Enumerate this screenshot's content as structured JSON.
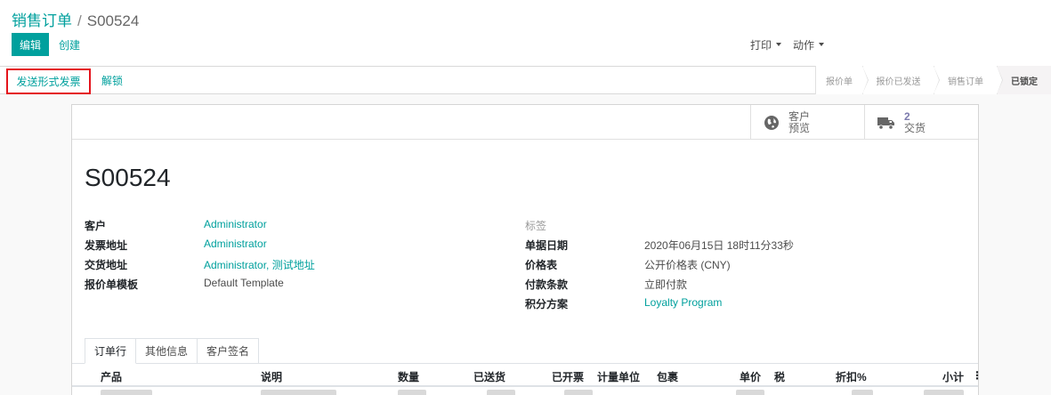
{
  "breadcrumb": {
    "parent": "销售订单",
    "current": "S00524"
  },
  "toolbar": {
    "edit": "编辑",
    "create": "创建",
    "print": "打印",
    "action": "动作"
  },
  "statusbar": {
    "send_proforma": "发送形式发票",
    "unlock": "解锁",
    "stages": [
      {
        "label": "报价单",
        "active": false
      },
      {
        "label": "报价已发送",
        "active": false
      },
      {
        "label": "销售订单",
        "active": false
      },
      {
        "label": "已锁定",
        "active": true
      }
    ]
  },
  "smart_buttons": {
    "preview_line1": "客户",
    "preview_line2": "预览",
    "delivery_count": "2",
    "delivery_label": "交货"
  },
  "record": {
    "name": "S00524",
    "left_fields": [
      {
        "label": "客户",
        "value": "Administrator"
      },
      {
        "label": "发票地址",
        "value": "Administrator"
      },
      {
        "label": "交货地址",
        "value": "Administrator, 测试地址"
      },
      {
        "label": "报价单模板",
        "value": "Default Template"
      }
    ],
    "tags_label": "标签",
    "right_fields": [
      {
        "label": "单据日期",
        "value": "2020年06月15日 18时11分33秒"
      },
      {
        "label": "价格表",
        "value": "公开价格表 (CNY)"
      },
      {
        "label": "付款条款",
        "value": "立即付款"
      },
      {
        "label": "积分方案",
        "value": "Loyalty Program"
      }
    ]
  },
  "tabs": [
    "订单行",
    "其他信息",
    "客户签名"
  ],
  "table": {
    "columns": [
      "产品",
      "说明",
      "数量",
      "已送货",
      "已开票",
      "计量单位",
      "包裹",
      "单价",
      "税",
      "折扣%",
      "小计"
    ]
  },
  "colors": {
    "accent": "#00A09D",
    "highlight_border": "#e4141c",
    "smart_number": "#7c7bad"
  }
}
